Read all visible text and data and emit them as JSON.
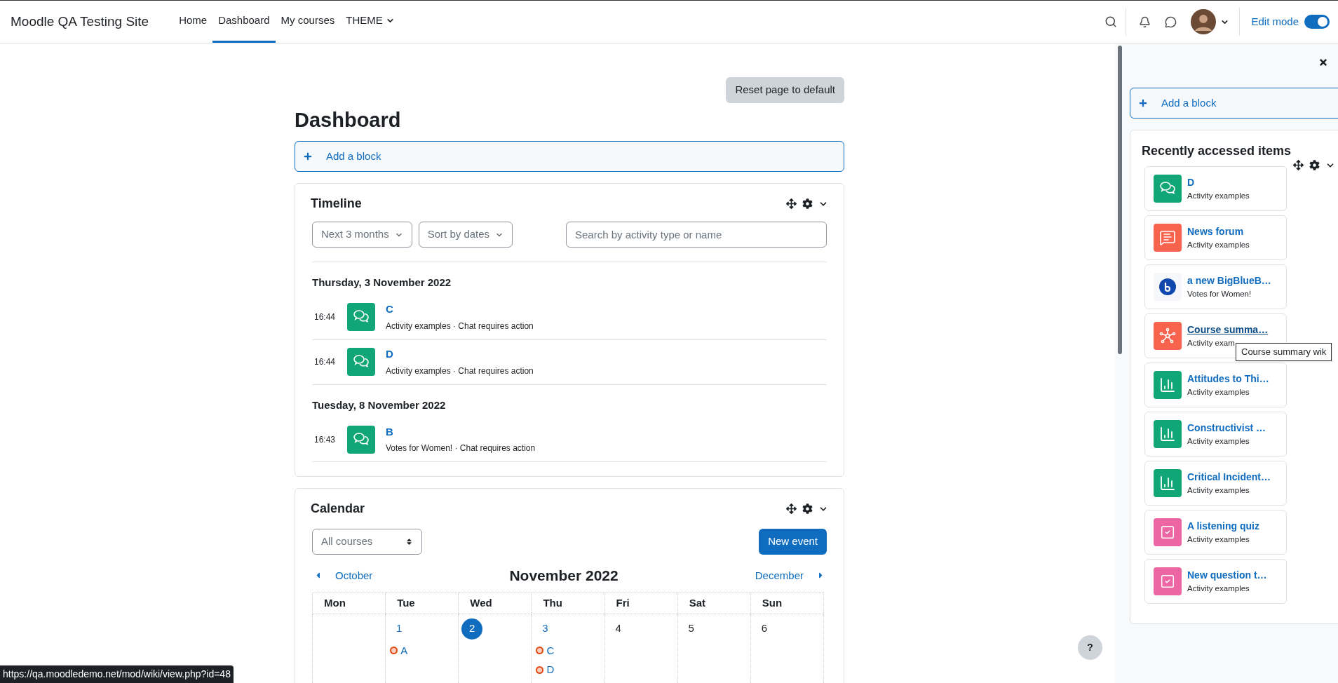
{
  "nav": {
    "site_name": "Moodle QA Testing Site",
    "links": [
      {
        "label": "Home",
        "selected": false,
        "kind": "link"
      },
      {
        "label": "Dashboard",
        "selected": true,
        "kind": "link"
      },
      {
        "label": "My courses",
        "selected": false,
        "kind": "link"
      },
      {
        "label": "THEME",
        "selected": false,
        "kind": "menu"
      }
    ],
    "edit_mode": {
      "label": "Edit mode",
      "on": true
    }
  },
  "main": {
    "reset_button": "Reset page to default",
    "title": "Dashboard",
    "add_block": "Add a block",
    "timeline": {
      "title": "Timeline",
      "filters": [
        "Next 3 months",
        "Sort by dates"
      ],
      "search": {
        "placeholder": "Search by activity type or name"
      },
      "groups": [
        {
          "date": "Thursday, 3 November 2022",
          "events": [
            {
              "time": "16:44",
              "name": "C",
              "meta": "Activity examples · Chat requires action",
              "kind": "chat"
            },
            {
              "time": "16:44",
              "name": "D",
              "meta": "Activity examples · Chat requires action",
              "kind": "chat"
            }
          ]
        },
        {
          "date": "Tuesday, 8 November 2022",
          "events": [
            {
              "time": "16:43",
              "name": "B",
              "meta": "Votes for Women! · Chat requires action",
              "kind": "chat"
            }
          ]
        }
      ]
    },
    "calendar": {
      "title": "Calendar",
      "course_select": "All courses",
      "new_event": "New event",
      "prev": "October",
      "next": "December",
      "month": "November 2022",
      "weekdays": [
        "Mon",
        "Tue",
        "Wed",
        "Thu",
        "Fri",
        "Sat",
        "Sun"
      ],
      "weeks": [
        {
          "days": [
            {
              "kind": "blank"
            },
            {
              "kind": "day",
              "day": "1",
              "today": false,
              "events": [
                {
                  "name": "A"
                }
              ]
            },
            {
              "kind": "day",
              "day": "2",
              "today": true
            },
            {
              "kind": "day",
              "day": "3",
              "today": false,
              "events": [
                {
                  "name": "C"
                },
                {
                  "name": "D"
                }
              ]
            },
            {
              "kind": "day",
              "day": "4",
              "today": false
            },
            {
              "kind": "day",
              "day": "5",
              "today": false
            },
            {
              "kind": "day",
              "day": "6",
              "today": false
            }
          ]
        }
      ]
    }
  },
  "drawer": {
    "add_block": "Add a block",
    "recent": {
      "title": "Recently accessed items",
      "items": [
        {
          "name": "D",
          "subtitle": "Activity examples",
          "kind": "chat",
          "hovered": false
        },
        {
          "name": "News forum",
          "subtitle": "Activity examples",
          "kind": "forum",
          "hovered": false
        },
        {
          "name": "a new BigBlueB…",
          "subtitle": "Votes for Women!",
          "kind": "bbb",
          "hovered": false
        },
        {
          "name": "Course summa…",
          "subtitle": "Activity exam",
          "kind": "wiki",
          "hovered": true
        },
        {
          "name": "Attitudes to Thi…",
          "subtitle": "Activity examples",
          "kind": "feedback",
          "hovered": false
        },
        {
          "name": "Constructivist …",
          "subtitle": "Activity examples",
          "kind": "feedback",
          "hovered": false
        },
        {
          "name": "Critical Incident…",
          "subtitle": "Activity examples",
          "kind": "feedback",
          "hovered": false
        },
        {
          "name": "A listening quiz",
          "subtitle": "Activity examples",
          "kind": "quiz",
          "hovered": false
        },
        {
          "name": "New question t…",
          "subtitle": "Activity examples",
          "kind": "quiz",
          "hovered": false
        }
      ]
    },
    "tooltip": "Course summary wik"
  },
  "help_button": "?",
  "status_url": "https://qa.moodledemo.net/mod/wiki/view.php?id=48"
}
